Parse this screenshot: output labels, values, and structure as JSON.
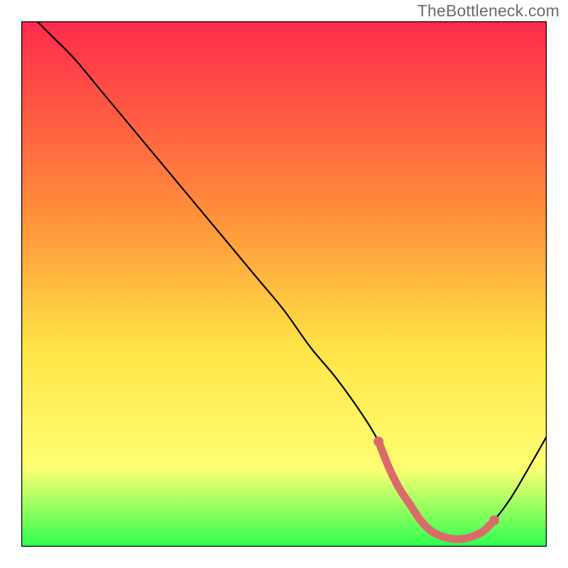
{
  "watermark": "TheBottleneck.com",
  "colors": {
    "gradient_top": "#ff2a4d",
    "gradient_mid1": "#ff8a3a",
    "gradient_mid2": "#ffe345",
    "gradient_mid3": "#ffff73",
    "gradient_bottom": "#2fff4f",
    "curve": "#000000",
    "highlight": "#db6b6b",
    "frame": "#000000"
  },
  "chart_data": {
    "type": "line",
    "title": "",
    "xlabel": "",
    "ylabel": "",
    "xlim": [
      0,
      100
    ],
    "ylim": [
      0,
      100
    ],
    "grid": false,
    "legend": false,
    "series": [
      {
        "name": "bottleneck-curve",
        "x": [
          3,
          6,
          10,
          15,
          20,
          25,
          30,
          35,
          40,
          45,
          50,
          55,
          60,
          65,
          68,
          70,
          72,
          75,
          78,
          80,
          82,
          84,
          86,
          88,
          90,
          93,
          96,
          100
        ],
        "y": [
          100,
          97,
          93,
          87,
          81,
          75,
          69,
          63,
          57,
          51,
          45,
          38,
          32,
          25,
          20,
          15,
          11,
          6,
          3,
          2,
          1.5,
          1.5,
          2,
          3,
          5,
          9,
          14,
          21
        ]
      },
      {
        "name": "sweet-spot-highlight",
        "x": [
          68,
          70,
          72,
          74,
          76,
          78,
          80,
          82,
          84,
          86,
          88,
          90
        ],
        "y": [
          20,
          15,
          11,
          8,
          5,
          3,
          2,
          1.5,
          1.5,
          2,
          3,
          5
        ]
      }
    ]
  }
}
